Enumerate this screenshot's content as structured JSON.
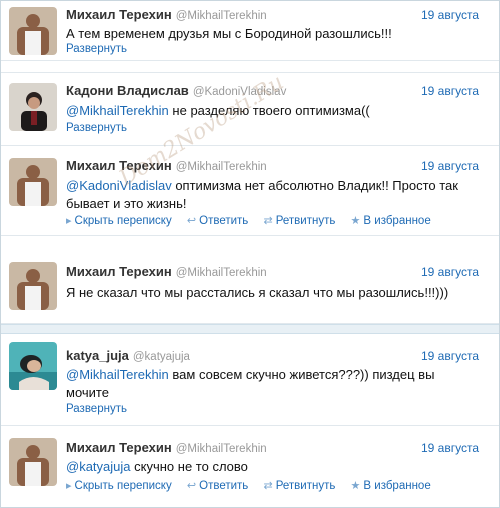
{
  "tweets": [
    {
      "name": "Михаил Терехин",
      "handle": "@MikhailTerekhin",
      "date": "19 августа",
      "text": "А тем временем друзья мы с Бородиной разошлись!!!",
      "expand": "Развернуть"
    },
    {
      "name": "Кадони Владислав",
      "handle": "@KadoniVladislav",
      "date": "19 августа",
      "mention": "@MikhailTerekhin",
      "text": "не разделяю твоего оптимизма((",
      "expand": "Развернуть"
    },
    {
      "name": "Михаил Терехин",
      "handle": "@MikhailTerekhin",
      "date": "19 августа",
      "mention": "@KadoniVladislav",
      "text": "оптимизма нет абсолютно Владик!! Просто так бывает и это жизнь!",
      "actions": {
        "hide": "Скрыть переписку",
        "reply": "Ответить",
        "retweet": "Ретвитнуть",
        "favorite": "В избранное"
      }
    },
    {
      "name": "Михаил Терехин",
      "handle": "@MikhailTerekhin",
      "date": "19 августа",
      "text": "Я не сказал что мы расстались я сказал что мы разошлись!!!)))"
    },
    {
      "name": "katya_juja",
      "handle": "@katyajuja",
      "date": "19 августа",
      "mention": "@MikhailTerekhin",
      "text": "вам совсем скучно живется???)) пиздец вы мочите",
      "expand": "Развернуть"
    },
    {
      "name": "Михаил Терехин",
      "handle": "@MikhailTerekhin",
      "date": "19 августа",
      "mention": "@katyajuja",
      "text": "скучно не то слово",
      "actions": {
        "hide": "Скрыть переписку",
        "reply": "Ответить",
        "retweet": "Ретвитнуть",
        "favorite": "В избранное"
      }
    }
  ],
  "watermark": "Dom2Novosti.Ru",
  "icons": {
    "hide": "conversation-icon",
    "reply": "reply-icon",
    "retweet": "retweet-icon",
    "favorite": "star-icon"
  },
  "colors": {
    "link": "#1e6ab4",
    "separator_band": "#e8f0f5"
  }
}
